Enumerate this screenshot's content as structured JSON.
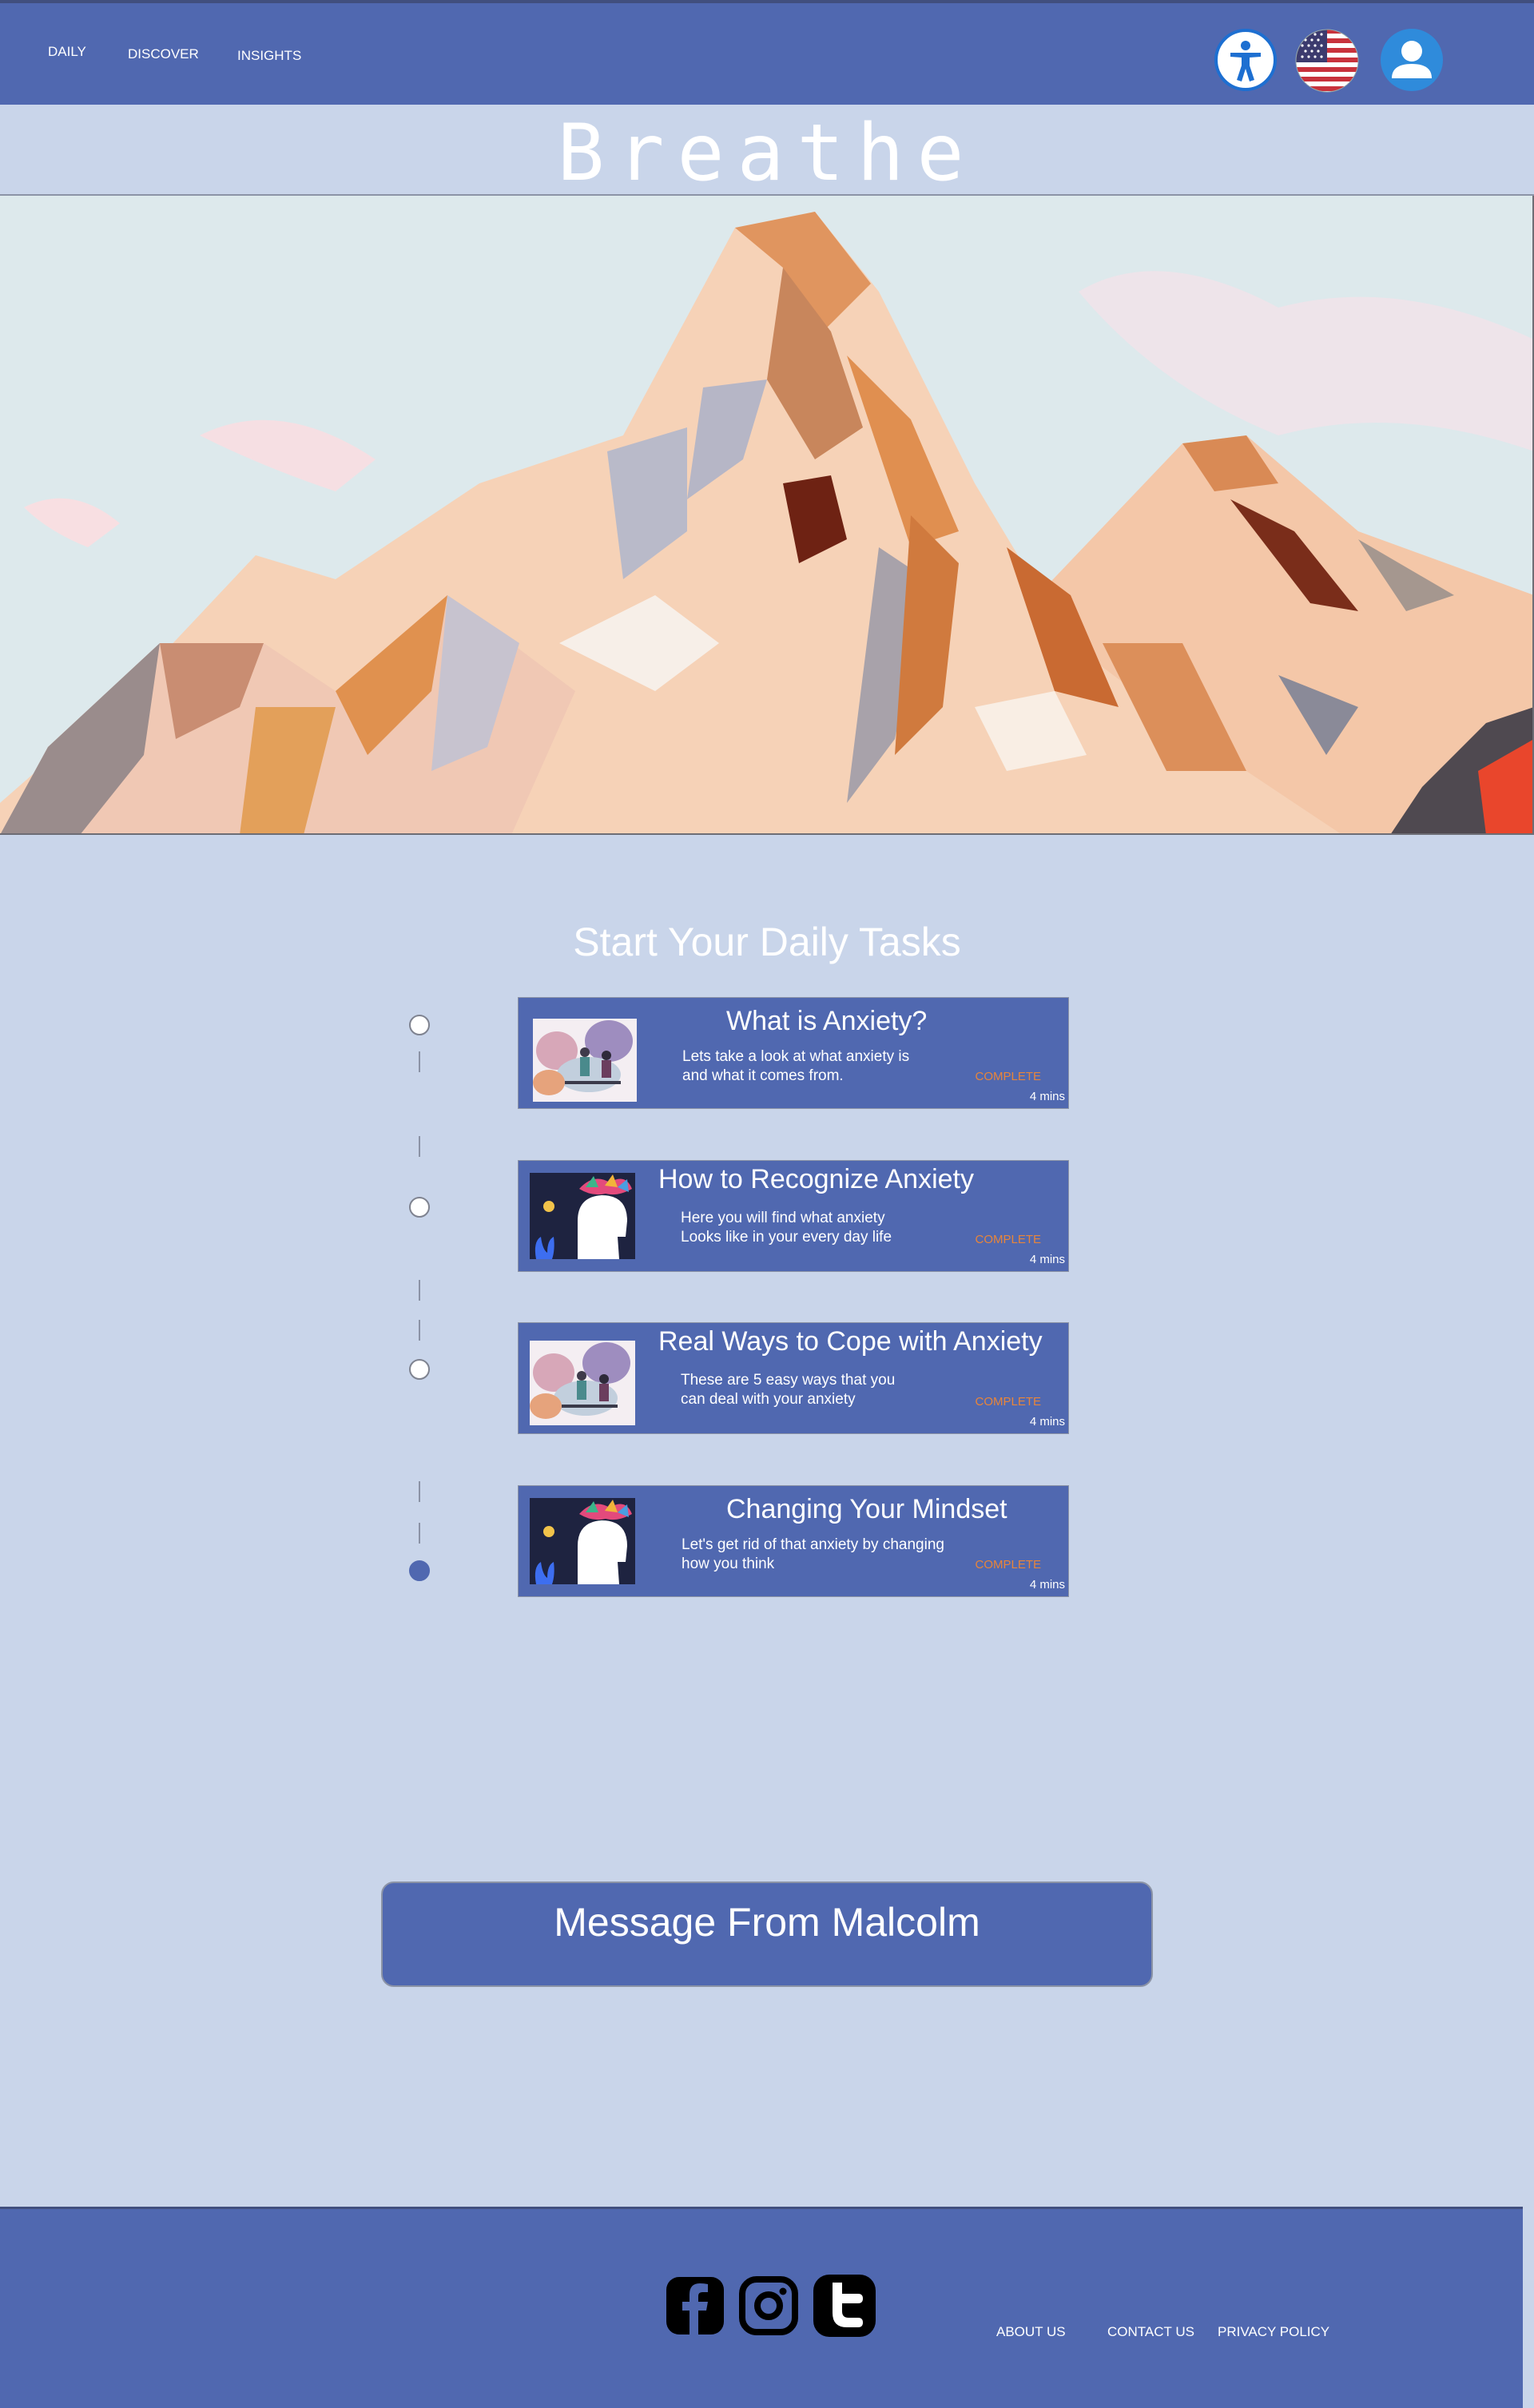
{
  "nav": {
    "items": [
      {
        "label": "DAILY"
      },
      {
        "label": "DISCOVER"
      },
      {
        "label": "INSIGHTS"
      }
    ],
    "icons": [
      "accessibility-icon",
      "us-flag-icon",
      "user-profile-icon"
    ]
  },
  "site": {
    "title": "Breathe"
  },
  "tasks": {
    "heading": "Start Your Daily Tasks",
    "items": [
      {
        "title": "What is Anxiety?",
        "description": "Lets take a look at what anxiety is\nand what it comes from.",
        "status": "COMPLETE",
        "duration": "4 mins",
        "done": false
      },
      {
        "title": "How to Recognize Anxiety",
        "description": "Here you will find what anxiety\nLooks like in your every day life",
        "status": "COMPLETE",
        "duration": "4 mins",
        "done": false
      },
      {
        "title": "Real Ways to Cope with Anxiety",
        "description": "These are 5 easy ways that you\ncan deal with your anxiety",
        "status": "COMPLETE",
        "duration": "4 mins",
        "done": false
      },
      {
        "title": "Changing Your Mindset",
        "description": "Let's get rid of that anxiety by changing\nhow you think",
        "status": "COMPLETE",
        "duration": "4 mins",
        "done": true
      }
    ]
  },
  "message": {
    "label": "Message From Malcolm"
  },
  "footer": {
    "social_icons": [
      "facebook-icon",
      "instagram-icon",
      "twitter-icon"
    ],
    "links": [
      {
        "label": "ABOUT US"
      },
      {
        "label": "CONTACT US"
      },
      {
        "label": "PRIVACY POLICY"
      }
    ]
  },
  "colors": {
    "primary": "#5068b0",
    "background": "#c9d5ea",
    "status": "#e8853a"
  }
}
